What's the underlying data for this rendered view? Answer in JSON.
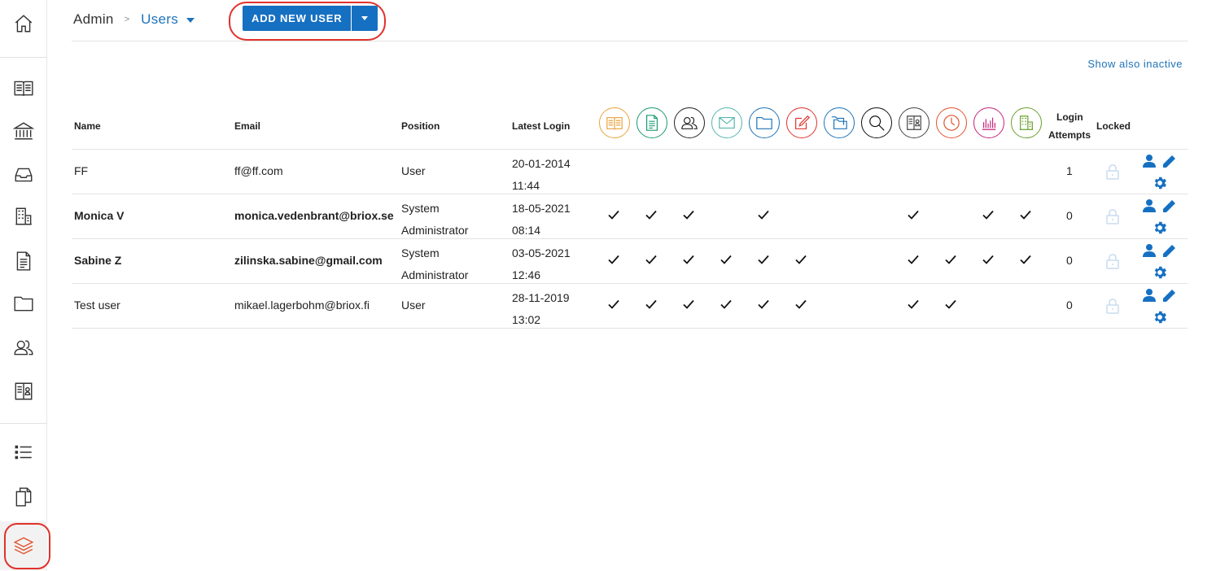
{
  "breadcrumb": {
    "root": "Admin",
    "separator": ">",
    "current": "Users"
  },
  "toolbar": {
    "add_user_label": "ADD NEW USER"
  },
  "show_inactive_label": "Show also inactive",
  "columns": {
    "name": "Name",
    "email": "Email",
    "position": "Position",
    "latest_login": "Latest Login",
    "login_attempts_1": "Login",
    "login_attempts_2": "Attempts",
    "locked": "Locked"
  },
  "module_icons": [
    {
      "name": "book-icon",
      "color": "#e8a33d"
    },
    {
      "name": "document-icon",
      "color": "#1a9a74"
    },
    {
      "name": "users-icon",
      "color": "#222222"
    },
    {
      "name": "mail-icon",
      "color": "#56b6b0"
    },
    {
      "name": "folder-icon",
      "color": "#1e73b8"
    },
    {
      "name": "edit-icon",
      "color": "#e0312c"
    },
    {
      "name": "folders-icon",
      "color": "#1e73b8"
    },
    {
      "name": "search-icon",
      "color": "#111111"
    },
    {
      "name": "contact-book-icon",
      "color": "#444444"
    },
    {
      "name": "clock-icon",
      "color": "#e0522f"
    },
    {
      "name": "bar-chart-icon",
      "color": "#c4267a"
    },
    {
      "name": "building-icon",
      "color": "#6aa12e"
    }
  ],
  "users": [
    {
      "name": "FF",
      "email": "ff@ff.com",
      "position": [
        "User"
      ],
      "login_date": "20-01-2014",
      "login_time": "11:44",
      "bold": false,
      "modules": [
        0,
        0,
        0,
        0,
        0,
        0,
        0,
        0,
        0,
        0,
        0,
        0
      ],
      "attempts": "1"
    },
    {
      "name": "Monica V",
      "email": "monica.vedenbrant@briox.se",
      "position": [
        "System",
        "Administrator"
      ],
      "login_date": "18-05-2021",
      "login_time": "08:14",
      "bold": true,
      "modules": [
        1,
        1,
        1,
        0,
        1,
        0,
        0,
        0,
        1,
        0,
        1,
        1
      ],
      "attempts": "0"
    },
    {
      "name": "Sabine Z",
      "email": "zilinska.sabine@gmail.com",
      "position": [
        "System",
        "Administrator"
      ],
      "login_date": "03-05-2021",
      "login_time": "12:46",
      "bold": true,
      "modules": [
        1,
        1,
        1,
        1,
        1,
        1,
        0,
        0,
        1,
        1,
        1,
        1
      ],
      "attempts": "0"
    },
    {
      "name": "Test user",
      "email": "mikael.lagerbohm@briox.fi",
      "position": [
        "User"
      ],
      "login_date": "28-11-2019",
      "login_time": "13:02",
      "bold": false,
      "modules": [
        1,
        1,
        1,
        1,
        1,
        1,
        0,
        0,
        1,
        1,
        0,
        0
      ],
      "attempts": "0"
    }
  ],
  "sidebar": [
    {
      "name": "home-icon"
    },
    {
      "name": "ledger-icon"
    },
    {
      "name": "bank-icon"
    },
    {
      "name": "inbox-icon"
    },
    {
      "name": "office-building-icon"
    },
    {
      "name": "document-icon"
    },
    {
      "name": "folder-icon"
    },
    {
      "name": "users-icon"
    },
    {
      "name": "contact-book-icon"
    },
    {
      "name": "list-icon"
    },
    {
      "name": "copy-icon"
    },
    {
      "name": "layers-icon"
    }
  ]
}
